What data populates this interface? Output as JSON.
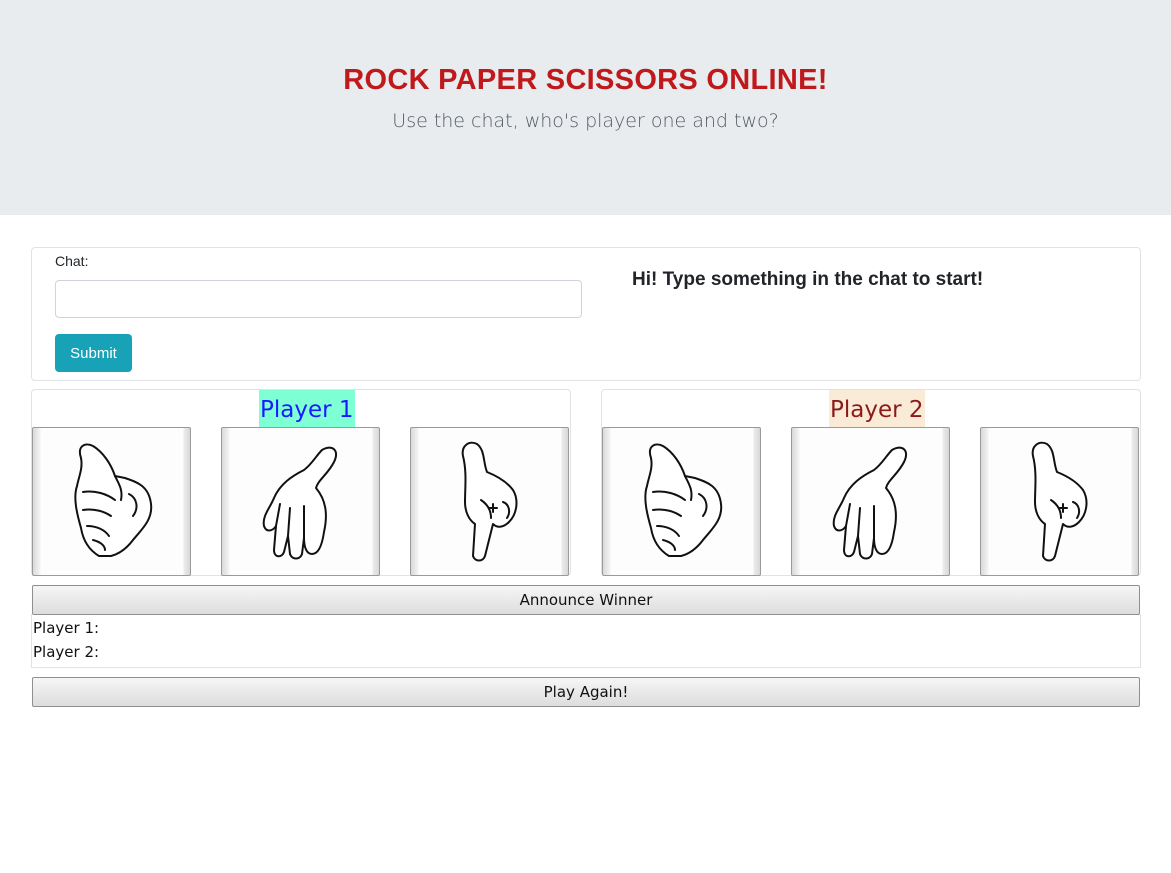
{
  "header": {
    "title": "ROCK PAPER SCISSORS ONLINE!",
    "subtitle": "Use the chat, who's player one and two?"
  },
  "chat": {
    "label": "Chat:",
    "input_value": "",
    "submit_label": "Submit",
    "message": "Hi! Type something in the chat to start!"
  },
  "players": [
    {
      "name": "Player 1",
      "name_bg": "#7fffd4",
      "name_color": "#1a1aff",
      "choices": [
        {
          "icon": "rock-hand-icon",
          "label": "rock"
        },
        {
          "icon": "paper-hand-icon",
          "label": "paper"
        },
        {
          "icon": "scissors-hand-icon",
          "label": "scissors"
        }
      ]
    },
    {
      "name": "Player 2",
      "name_bg": "#faebd7",
      "name_color": "#8b1a1a",
      "choices": [
        {
          "icon": "rock-hand-icon",
          "label": "rock"
        },
        {
          "icon": "paper-hand-icon",
          "label": "paper"
        },
        {
          "icon": "scissors-hand-icon",
          "label": "scissors"
        }
      ]
    }
  ],
  "actions": {
    "announce_label": "Announce Winner",
    "play_again_label": "Play Again!"
  },
  "results": {
    "player1_label": "Player 1:",
    "player1_value": "",
    "player2_label": "Player 2:",
    "player2_value": ""
  },
  "colors": {
    "title": "#c0191b",
    "hero_bg": "#e9ecef",
    "submit_bg": "#17a2b8"
  }
}
